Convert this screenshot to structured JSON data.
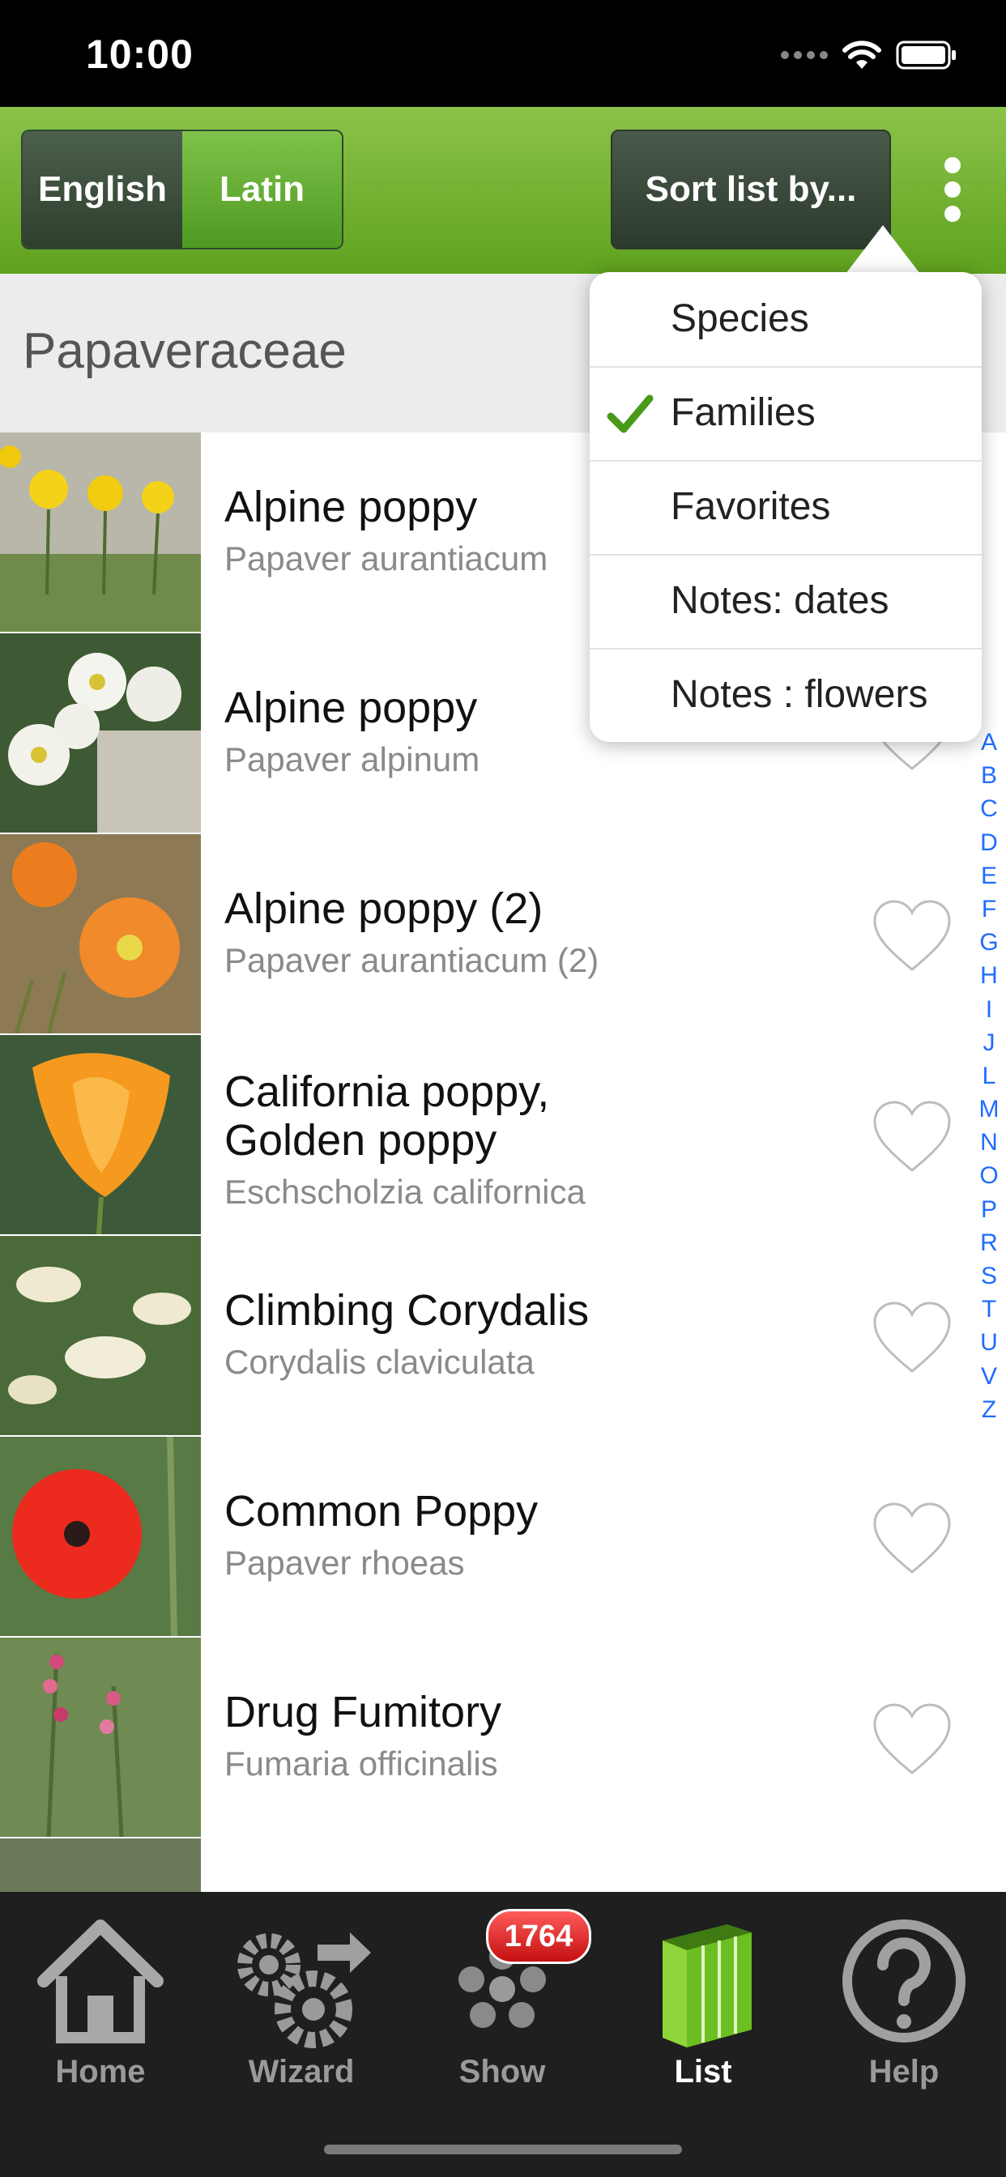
{
  "status_bar": {
    "time": "10:00"
  },
  "toolbar": {
    "language_options": [
      "English",
      "Latin"
    ],
    "selected_language": "Latin",
    "sort_label": "Sort list by...",
    "more_icon": "vertical-ellipsis-icon"
  },
  "section": {
    "title": "Papaveraceae"
  },
  "rows": [
    {
      "name": "Alpine poppy",
      "latin": "Papaver aurantiacum",
      "favorite": false
    },
    {
      "name": "Alpine poppy",
      "latin": "Papaver alpinum",
      "favorite": false
    },
    {
      "name": "Alpine poppy (2)",
      "latin": "Papaver aurantiacum (2)",
      "favorite": false
    },
    {
      "name": "California poppy,",
      "name2": "Golden poppy",
      "latin": "Eschscholzia californica",
      "favorite": false
    },
    {
      "name": "Climbing Corydalis",
      "latin": "Corydalis claviculata",
      "favorite": false
    },
    {
      "name": "Common Poppy",
      "latin": "Papaver rhoeas",
      "favorite": false
    },
    {
      "name": "Drug Fumitory",
      "latin": "Fumaria officinalis",
      "favorite": false
    }
  ],
  "index_letters": [
    "A",
    "B",
    "C",
    "D",
    "E",
    "F",
    "G",
    "H",
    "I",
    "J",
    "L",
    "M",
    "N",
    "O",
    "P",
    "R",
    "S",
    "T",
    "U",
    "V",
    "Z"
  ],
  "sort_menu": {
    "items": [
      "Species",
      "Families",
      "Favorites",
      "Notes: dates",
      "Notes : flowers"
    ],
    "selected": "Families",
    "check_color": "#4a9a1a"
  },
  "tabbar": {
    "tabs": [
      {
        "label": "Home",
        "icon": "house-icon"
      },
      {
        "label": "Wizard",
        "icon": "gears-arrow-icon"
      },
      {
        "label": "Show",
        "icon": "flower-icon"
      },
      {
        "label": "List",
        "icon": "books-icon"
      },
      {
        "label": "Help",
        "icon": "question-circle-icon"
      }
    ],
    "active": "List",
    "show_badge": "1764"
  },
  "colors": {
    "toolbar_green": "#6fb12c",
    "index_blue": "#1f6cff",
    "badge_red": "#d61a1a"
  }
}
